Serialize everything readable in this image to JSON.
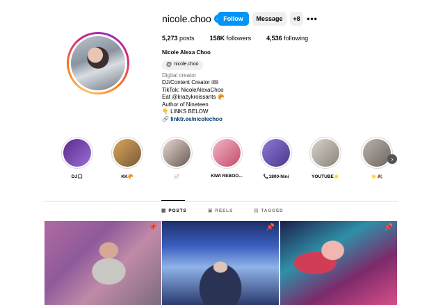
{
  "profile": {
    "username": "nicole.choo",
    "verified_glyph": "✓",
    "follow_label": "Follow",
    "message_label": "Message",
    "suggest_icon": "+8",
    "more_icon": "•••",
    "posts_count": "5,273",
    "posts_label": "posts",
    "followers_count": "158K",
    "followers_label": "followers",
    "following_count": "4,536",
    "following_label": "following",
    "full_name": "Nicole Alexa Choo",
    "threads_handle": "nicole.choo",
    "threads_icon": "@",
    "category": "Digital creator",
    "bio_lines": [
      "DJ/Content Creator 🎟",
      "TikTok: NicoleAlexaChoo",
      "Eat @krazykroissants 🥐",
      "Author of Nineteen",
      "👇 LINKS BELOW"
    ],
    "link_icon": "🔗",
    "link": "linktr.ee/nicolechoo"
  },
  "highlights": [
    {
      "label": "DJ🎧",
      "colors": [
        "#5b2a8a",
        "#9b6fd6"
      ]
    },
    {
      "label": "KK🥐",
      "colors": [
        "#d9a55a",
        "#7a5a3a"
      ]
    },
    {
      "label": "📈",
      "colors": [
        "#e6d8d0",
        "#6a5a55"
      ]
    },
    {
      "label": "KIWI REBOO...",
      "colors": [
        "#f2b7c6",
        "#c44a6a"
      ]
    },
    {
      "label": "📞1800-Nini",
      "colors": [
        "#8e77d8",
        "#4a3a8a"
      ]
    },
    {
      "label": "YOUTUBE⭐",
      "colors": [
        "#d8d4cc",
        "#8a8278"
      ]
    },
    {
      "label": "⭐🍂",
      "colors": [
        "#b9b3ad",
        "#6e665f"
      ]
    }
  ],
  "highlight_next_icon": "›",
  "tabs": [
    {
      "label": "POSTS",
      "icon": "▦",
      "active": true
    },
    {
      "label": "REELS",
      "icon": "▣",
      "active": false
    },
    {
      "label": "TAGGED",
      "icon": "▤",
      "active": false
    }
  ],
  "pin_icon": "📌"
}
